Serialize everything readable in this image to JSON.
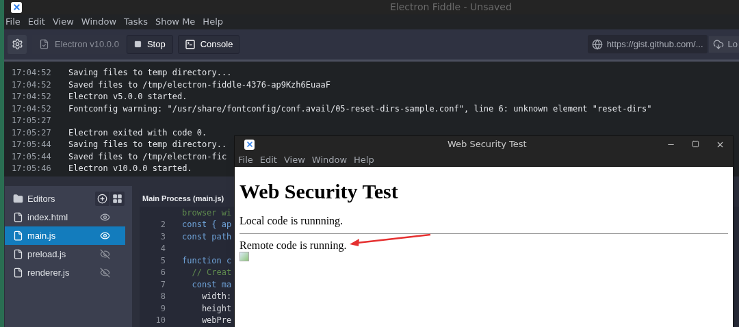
{
  "window": {
    "title": "Electron Fiddle - Unsaved"
  },
  "menu": [
    "File",
    "Edit",
    "View",
    "Window",
    "Tasks",
    "Show Me",
    "Help"
  ],
  "toolbar": {
    "version": "Electron v10.0.0",
    "stop": "Stop",
    "console": "Console",
    "gist_url": "https://gist.github.com/...",
    "load": "Lo"
  },
  "console": [
    {
      "time": "17:04:52",
      "text": "Saving files to temp directory..."
    },
    {
      "time": "17:04:52",
      "text": "Saved files to /tmp/electron-fiddle-4376-ap9Kzh6EuaaF"
    },
    {
      "time": "17:04:52",
      "text": "Electron v5.0.0 started."
    },
    {
      "time": "17:04:52",
      "text": "Fontconfig warning: \"/usr/share/fontconfig/conf.avail/05-reset-dirs-sample.conf\", line 6: unknown element \"reset-dirs\""
    },
    {
      "time": "17:05:27"
    },
    {
      "time": "17:05:27",
      "text": "Electron exited with code 0."
    },
    {
      "time": "17:05:44",
      "text": "Saving files to temp directory.."
    },
    {
      "time": "17:05:44",
      "text": "Saved files to /tmp/electron-fic"
    },
    {
      "time": "17:05:46",
      "text": "Electron v10.0.0 started."
    }
  ],
  "sidebar": {
    "title": "Editors",
    "items": [
      {
        "label": "index.html",
        "selected": false,
        "visible": true
      },
      {
        "label": "main.js",
        "selected": true,
        "visible": true
      },
      {
        "label": "preload.js",
        "selected": false,
        "visible": false
      },
      {
        "label": "renderer.js",
        "selected": false,
        "visible": false
      }
    ]
  },
  "editor": {
    "tab": "Main Process (main.js)",
    "lines": [
      {
        "text": "browser wi",
        "kind": "comment"
      },
      {
        "number": "2",
        "text": "const { ap",
        "kind": "code"
      },
      {
        "number": "3",
        "text": "const path",
        "kind": "code"
      },
      {
        "number": "4",
        "kind": "code"
      },
      {
        "number": "5",
        "text": "function c",
        "kind": "code"
      },
      {
        "number": "6",
        "text": "  // Creat",
        "kind": "comment"
      },
      {
        "number": "7",
        "text": "  const ma",
        "kind": "code"
      },
      {
        "number": "8",
        "text": "    width:",
        "kind": "plain"
      },
      {
        "number": "9",
        "text": "    height",
        "kind": "plain"
      },
      {
        "number": "10",
        "text": "    webPre",
        "kind": "plain"
      }
    ]
  },
  "app_window": {
    "title": "Web Security Test",
    "menu": [
      "File",
      "Edit",
      "View",
      "Window",
      "Help"
    ],
    "heading": "Web Security Test",
    "local": "Local code is runnning.",
    "remote": "Remote code is running."
  }
}
